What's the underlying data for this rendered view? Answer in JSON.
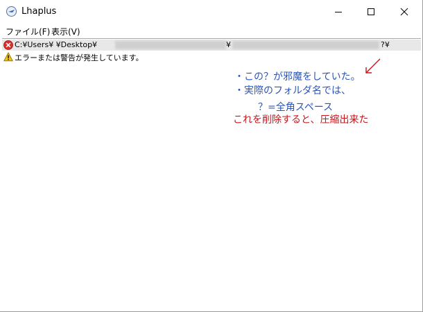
{
  "window": {
    "title": "Lhaplus",
    "controls": {
      "minimize_icon": "minimize-icon",
      "maximize_icon": "maximize-icon",
      "close_icon": "close-icon"
    }
  },
  "menu": {
    "file": "ファイル(F)",
    "view": "表示(V)"
  },
  "log": {
    "path_row": {
      "status_icon": "error-icon",
      "path_text": "C:¥Users¥        ¥Desktop¥",
      "mid_sep": "¥",
      "end_text": "?¥"
    },
    "message_row": {
      "status_icon": "warning-icon",
      "text": "エラーまたは警告が発生しています。"
    }
  },
  "annotation": {
    "line1": "・この？が邪魔をしていた。",
    "line2": "・実際のフォルダ名では、",
    "line3": "？=全角スペース",
    "line4": "これを削除すると、圧縮出来た",
    "colors": {
      "blue": "#2a55b8",
      "red": "#c4161c"
    }
  }
}
